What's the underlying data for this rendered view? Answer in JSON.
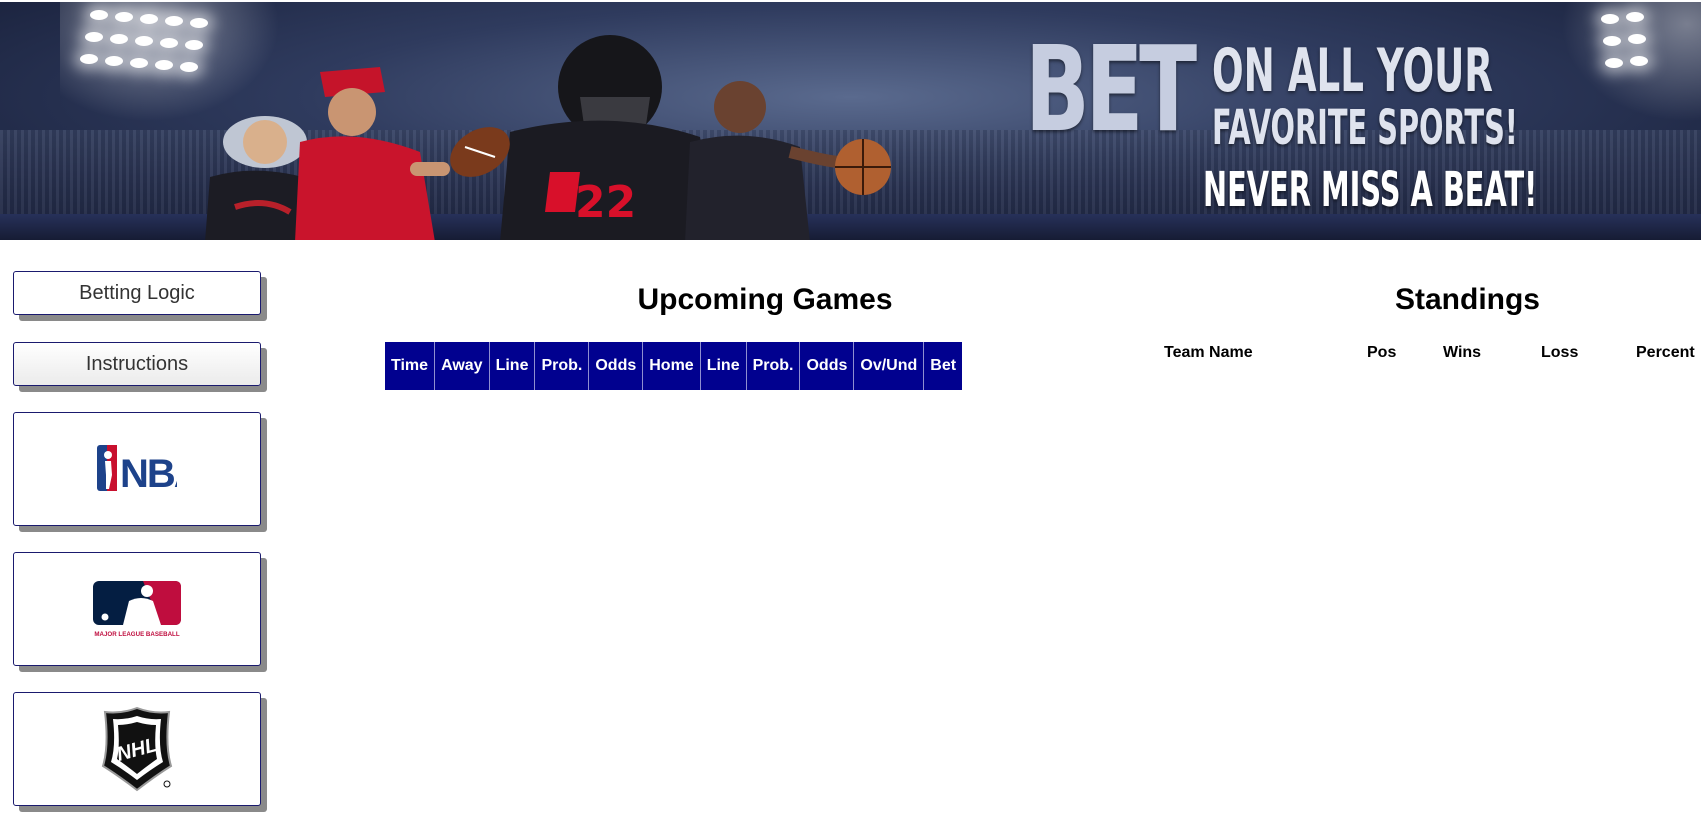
{
  "banner": {
    "tagline_big": "BET",
    "tagline_line1": "ON ALL YOUR",
    "tagline_line2": "FAVORITE SPORTS!",
    "tagline_line3": "NEVER MISS A BEAT!"
  },
  "sidebar": {
    "betting_logic_label": "Betting Logic",
    "instructions_label": "Instructions",
    "leagues": [
      {
        "icon": "nba-logo-icon",
        "text": "NBA"
      },
      {
        "icon": "mlb-logo-icon",
        "text": "MAJOR LEAGUE BASEBALL"
      },
      {
        "icon": "nhl-logo-icon",
        "text": "NHL"
      }
    ]
  },
  "upcoming_games": {
    "title": "Upcoming Games",
    "columns": [
      "Time",
      "Away",
      "Line",
      "Prob.",
      "Odds",
      "Home",
      "Line",
      "Prob.",
      "Odds",
      "Ov/Und",
      "Bet"
    ]
  },
  "standings": {
    "title": "Standings",
    "columns": [
      "Team Name",
      "Pos",
      "Wins",
      "Loss",
      "Percent"
    ]
  },
  "colors": {
    "table_header_bg": "#01018f",
    "button_border": "#1a1a6e",
    "button_shadow": "#8a8a8a"
  }
}
